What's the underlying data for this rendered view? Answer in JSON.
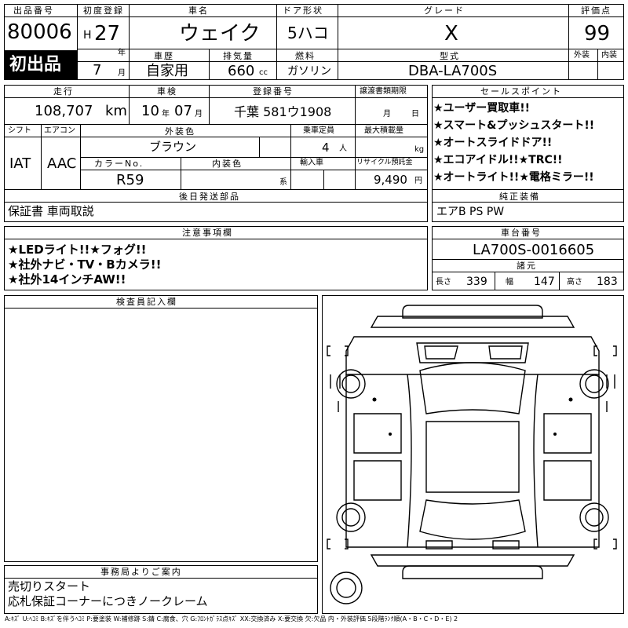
{
  "sheet": {
    "lot_label": "出品番号",
    "lot_number": "80006",
    "first_listing": "初出品",
    "registration_label": "初度登録",
    "era": "H",
    "year": "27",
    "year_unit": "年",
    "month": "7",
    "month_unit": "月",
    "car_name_label": "車名",
    "car_name": "ウェイク",
    "door_label": "ドア形状",
    "door_type": "5ハコ",
    "grade_label": "グレード",
    "grade": "X",
    "score_label": "評価点",
    "score": "99",
    "exterior_label": "外装",
    "interior_label": "内装",
    "history_label": "車歴",
    "history": "自家用",
    "displacement_label": "排気量",
    "displacement": "660",
    "displacement_unit": "cc",
    "fuel_label": "燃料",
    "fuel": "ガソリン",
    "model_label": "型式",
    "model": "DBA-LA700S",
    "mileage_label": "走行",
    "mileage": "108,707",
    "mileage_unit": "km",
    "inspection_label": "車検",
    "inspection_year": "10",
    "inspection_month": "07",
    "plate_label": "登録番号",
    "plate": "千葉 581ウ1908",
    "transfer_label": "譲渡書類期限",
    "transfer_month_unit": "月",
    "transfer_day_unit": "日",
    "shift_label": "シフト",
    "shift": "IAT",
    "ac_label": "エアコン",
    "ac": "AAC",
    "ext_color_label": "外装色",
    "ext_color": "ブラウン",
    "capacity_label": "乗車定員",
    "capacity": "4",
    "capacity_unit": "人",
    "load_label": "最大積載量",
    "load_unit": "kg",
    "color_no_label": "カラーNo.",
    "color_no": "R59",
    "int_color_label": "内装色",
    "int_color_unit": "系",
    "import_label": "輸入車",
    "recycle_label": "リサイクル預託金",
    "recycle": "9,490",
    "recycle_unit": "円",
    "later_parts_label": "後日発送部品",
    "later_parts": "保証書 車両取説",
    "sales_label": "セールスポイント",
    "sales_points": [
      "★ユーザー買取車!!",
      "★スマート&プッシュスタート!!",
      "★オートスライドドア!!",
      "★エコアイドル!!★TRC!!",
      "★オートライト!!★電格ミラー!!"
    ],
    "equipment_label": "純正装備",
    "equipment": "エアB PS PW",
    "notes_label": "注意事項欄",
    "notes": [
      "★LEDライト!!★フォグ!!",
      "★社外ナビ・TV・Bカメラ!!",
      "★社外14インチAW!!"
    ],
    "chassis_label": "車台番号",
    "chassis": "LA700S-0016605",
    "dims_label": "諸元",
    "length_label": "長さ",
    "length": "339",
    "width_label": "幅",
    "width": "147",
    "height_label": "高さ",
    "height": "183",
    "inspector_label": "検査員記入欄",
    "office_label": "事務局よりご案内",
    "office_lines": [
      "売切りスタート",
      "応札保証コーナーにつきノークレーム"
    ],
    "legend": "A:ｷｽﾞ U:ﾍｺﾐ B:ｷｽﾞを伴うﾍｺﾐ P:要塗装 W:補修跡 S:錆 C:腐食、穴 G:ﾌﾛﾝﾄｶﾞﾗｽ点ｷｽﾞ XX:交換済み X:要交換 欠:欠品 内・外装評価 5段階ﾗﾝｸ順(A・B・C・D・E) 2"
  }
}
